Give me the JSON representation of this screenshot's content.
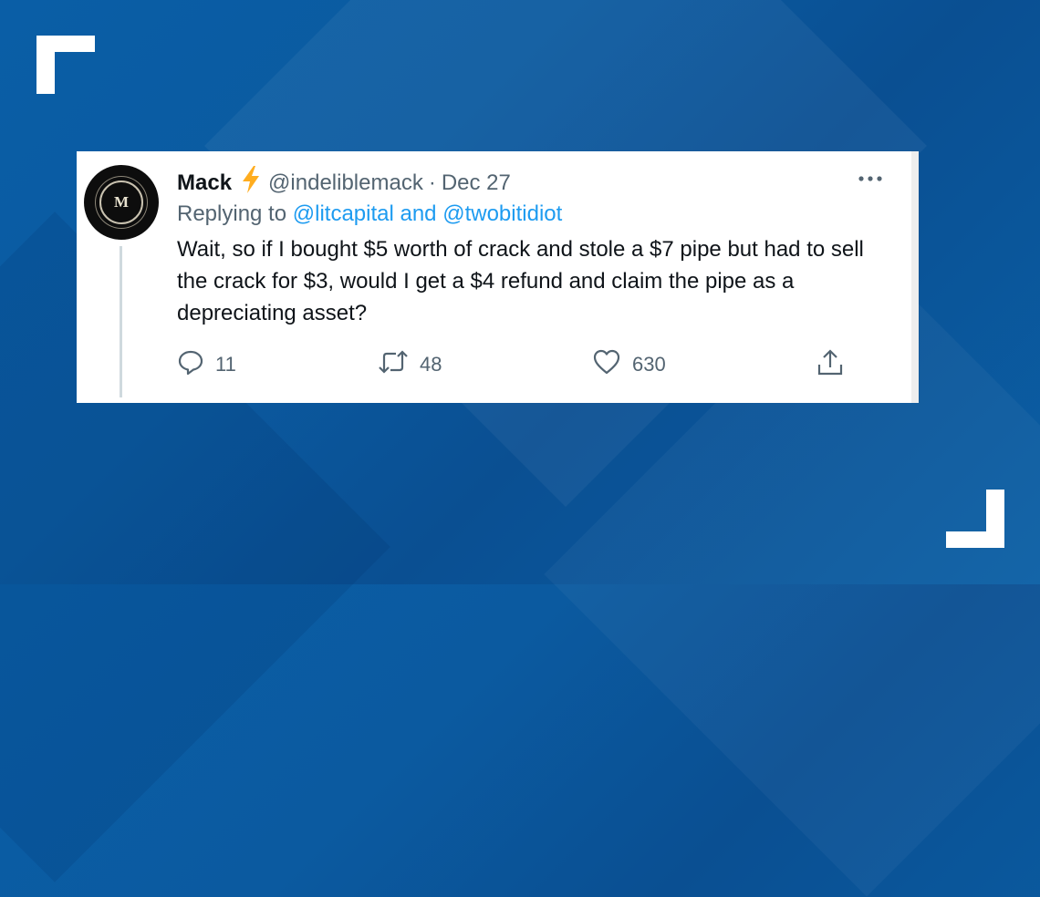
{
  "tweet": {
    "author_name": "Mack",
    "author_emoji": "⚡",
    "handle": "@indeliblemack",
    "separator": "·",
    "date": "Dec 27",
    "avatar_letter": "M",
    "replying_prefix": "Replying to",
    "replying_targets": "@litcapital and @twobitidiot",
    "text": "Wait, so if I bought $5 worth of crack and stole a $7 pipe but had to sell the crack for $3, would I get a $4 refund and claim the pipe as a depreciating asset?",
    "reply_count": "11",
    "retweet_count": "48",
    "like_count": "630"
  },
  "colors": {
    "background": "#0a5ea6",
    "card": "#ffffff",
    "link": "#1d9bf0",
    "muted": "#536471",
    "text": "#0f1419",
    "bolt": "#ffad1f"
  },
  "icons": [
    "more-icon",
    "reply-icon",
    "retweet-icon",
    "like-icon",
    "share-icon"
  ]
}
